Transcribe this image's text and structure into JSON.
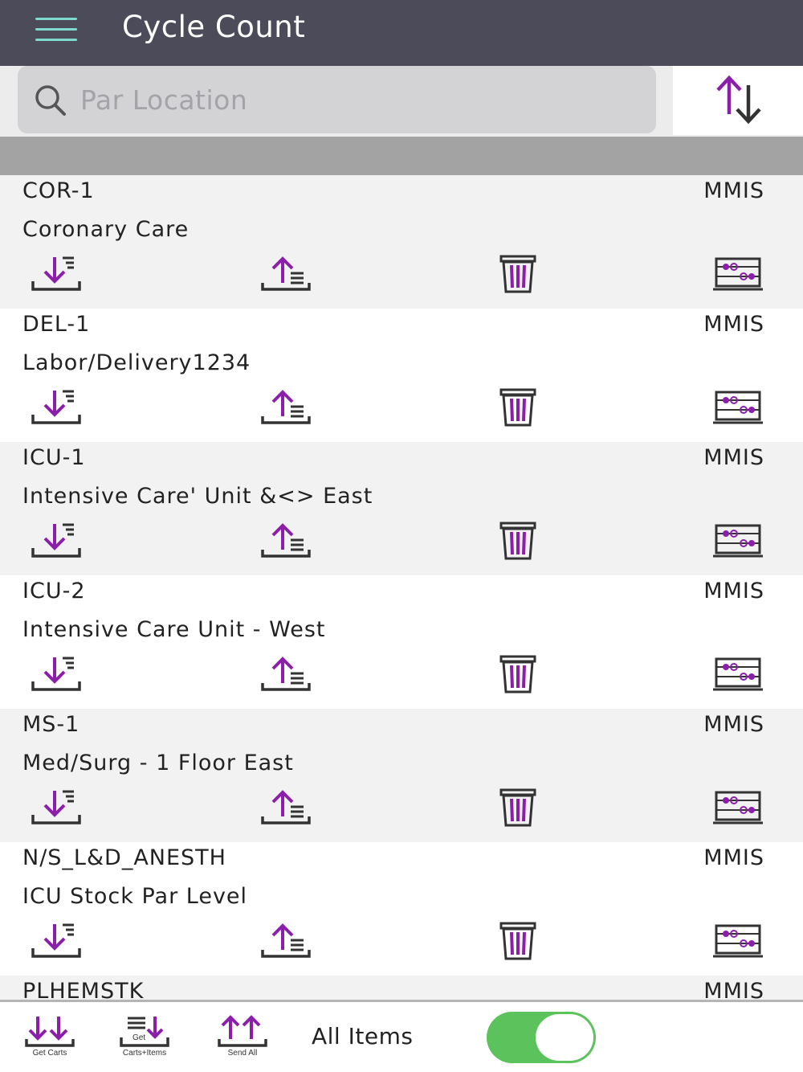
{
  "header": {
    "title": "Cycle Count"
  },
  "search": {
    "placeholder": "Par Location",
    "value": ""
  },
  "accent_color": "#8b1fa9",
  "rows": [
    {
      "code": "COR-1",
      "source": "MMIS",
      "description": "Coronary Care"
    },
    {
      "code": "DEL-1",
      "source": "MMIS",
      "description": "Labor/Delivery1234"
    },
    {
      "code": "ICU-1",
      "source": "MMIS",
      "description": "Intensive Care' Unit &<> East"
    },
    {
      "code": "ICU-2",
      "source": "MMIS",
      "description": "Intensive Care Unit - West"
    },
    {
      "code": "MS-1",
      "source": "MMIS",
      "description": "Med/Surg - 1 Floor East"
    },
    {
      "code": "N/S_L&D_ANESTH",
      "source": "MMIS",
      "description": "ICU Stock Par Level"
    },
    {
      "code": "PLHEMSTK",
      "source": "MMIS",
      "description": ""
    }
  ],
  "row_actions": {
    "icons": [
      "download-list-icon",
      "upload-list-icon",
      "trash-icon",
      "abacus-icon"
    ]
  },
  "bottom_bar": {
    "get_carts_label": "Get Carts",
    "get_carts_items_label": "Carts+Items",
    "get_carts_items_icon_text": "Get",
    "send_all_label": "Send All",
    "all_items_label": "All Items",
    "all_items_toggle_on": true
  }
}
